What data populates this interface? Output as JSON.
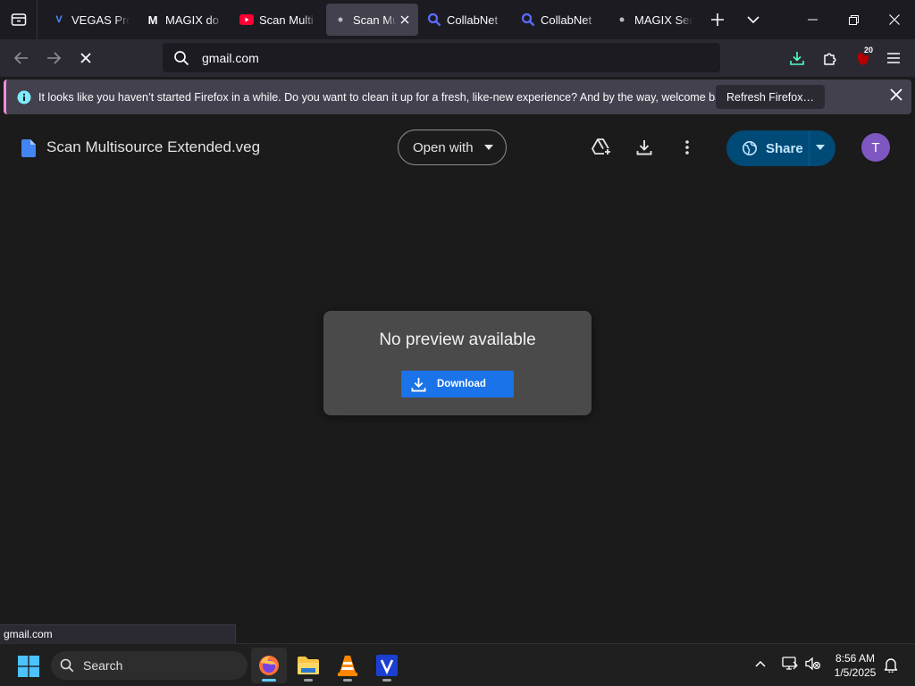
{
  "tabs": [
    {
      "label": "VEGAS Pro",
      "favicon": "vegas-v-icon",
      "favicon_color": "#4a90ff"
    },
    {
      "label": "MAGIX do",
      "favicon": "magix-m-icon",
      "favicon_color": "#ffffff"
    },
    {
      "label": "Scan Multi",
      "favicon": "youtube-icon",
      "favicon_color": "#ff0033"
    },
    {
      "label": "Scan Mu",
      "favicon": "dot-icon",
      "active": true
    },
    {
      "label": "CollabNet",
      "favicon": "search-magnifier-icon",
      "favicon_color": "#5a6cff"
    },
    {
      "label": "CollabNet",
      "favicon": "search-magnifier-icon",
      "favicon_color": "#5a6cff"
    },
    {
      "label": "MAGIX Ser",
      "favicon": "dot-icon"
    }
  ],
  "navbar": {
    "url": "gmail.com",
    "extensions_badge": "20"
  },
  "notification": {
    "message": "It looks like you haven’t started Firefox in a while. Do you want to clean it up for a fresh, like-new experience? And by the way, welcome back!",
    "refresh_label": "Refresh Firefox…"
  },
  "viewer": {
    "file_name": "Scan Multisource Extended.veg",
    "open_with_label": "Open with",
    "share_label": "Share",
    "avatar_initial": "T",
    "no_preview_text": "No preview available",
    "download_label": "Download"
  },
  "status_url": "gmail.com",
  "taskbar": {
    "search_label": "Search",
    "apps": [
      "firefox",
      "file-explorer",
      "vlc",
      "vegas"
    ],
    "time": "8:56 AM",
    "date": "1/5/2025"
  },
  "colors": {
    "accent_blue": "#1a73e8",
    "share_bg": "#004a77",
    "avatar_bg": "#7e57c2",
    "notice_accent": "#ff8ae0"
  }
}
